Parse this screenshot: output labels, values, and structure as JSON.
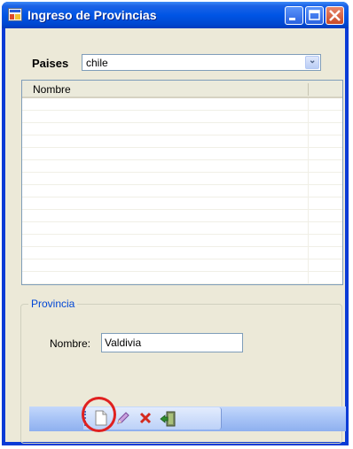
{
  "window": {
    "title": "Ingreso de Provincias",
    "title_color": "#ffffff",
    "titlebar_color": "#0055e5"
  },
  "filter": {
    "label": "Paises",
    "selected_value": "chile"
  },
  "grid": {
    "columns": [
      "Nombre"
    ],
    "rows": []
  },
  "details_group": {
    "title": "Provincia",
    "nombre_label": "Nombre:",
    "nombre_value": "Valdivia"
  },
  "toolbar": {
    "buttons": [
      {
        "name": "new",
        "icon": "new-document-icon"
      },
      {
        "name": "edit",
        "icon": "pencil-icon"
      },
      {
        "name": "delete",
        "icon": "red-x-icon"
      },
      {
        "name": "exit",
        "icon": "exit-door-icon"
      }
    ]
  },
  "annotation": {
    "color": "#e0201f",
    "target": "new"
  }
}
